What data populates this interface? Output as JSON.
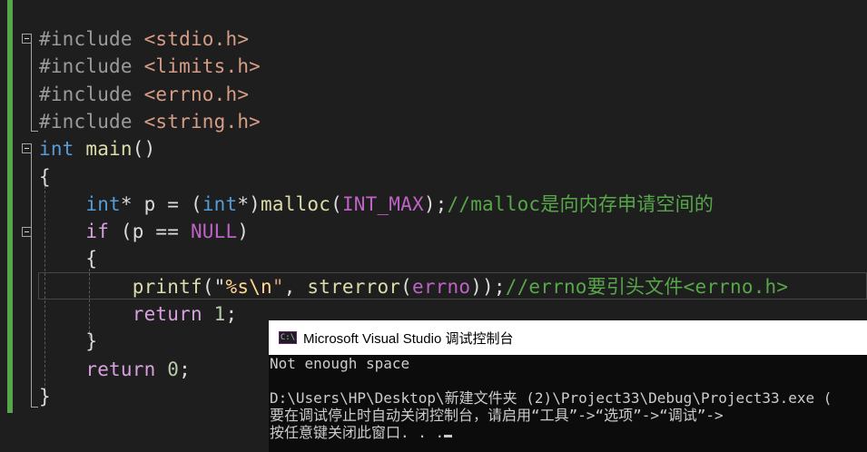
{
  "editor": {
    "lines": [
      [
        {
          "t": "#include ",
          "c": "pp"
        },
        {
          "t": "<stdio.h>",
          "c": "inc"
        }
      ],
      [
        {
          "t": "#include ",
          "c": "pp"
        },
        {
          "t": "<limits.h>",
          "c": "inc"
        }
      ],
      [
        {
          "t": "#include ",
          "c": "pp"
        },
        {
          "t": "<errno.h>",
          "c": "inc"
        }
      ],
      [
        {
          "t": "#include ",
          "c": "pp"
        },
        {
          "t": "<string.h>",
          "c": "inc"
        }
      ],
      [
        {
          "t": "int",
          "c": "kw"
        },
        {
          "t": " "
        },
        {
          "t": "main",
          "c": "fn"
        },
        {
          "t": "()"
        }
      ],
      [
        {
          "t": "{"
        }
      ],
      [
        {
          "t": "    "
        },
        {
          "t": "int",
          "c": "kw"
        },
        {
          "t": "* "
        },
        {
          "t": "p"
        },
        {
          "t": " = ("
        },
        {
          "t": "int",
          "c": "kw"
        },
        {
          "t": "*)"
        },
        {
          "t": "malloc",
          "c": "fn"
        },
        {
          "t": "("
        },
        {
          "t": "INT_MAX",
          "c": "mac"
        },
        {
          "t": ");"
        },
        {
          "t": "//malloc是向内存申请空间的",
          "c": "cmt"
        }
      ],
      [
        {
          "t": "    "
        },
        {
          "t": "if",
          "c": "ctl"
        },
        {
          "t": " (p == "
        },
        {
          "t": "NULL",
          "c": "mac"
        },
        {
          "t": ")"
        }
      ],
      [
        {
          "t": "    {"
        }
      ],
      [
        {
          "t": "        "
        },
        {
          "t": "printf",
          "c": "fn"
        },
        {
          "t": "(\""
        },
        {
          "t": "%s",
          "c": "esc"
        },
        {
          "t": "\\n",
          "c": "esc"
        },
        {
          "t": "\"",
          "c": "str"
        },
        {
          "t": ", "
        },
        {
          "t": "strerror",
          "c": "fn"
        },
        {
          "t": "("
        },
        {
          "t": "errno",
          "c": "mac"
        },
        {
          "t": "));"
        },
        {
          "t": "//errno要引头文件<errno.h>",
          "c": "cmt"
        }
      ],
      [
        {
          "t": "        "
        },
        {
          "t": "return",
          "c": "ctl"
        },
        {
          "t": " "
        },
        {
          "t": "1",
          "c": "num"
        },
        {
          "t": ";"
        }
      ],
      [
        {
          "t": "    }"
        }
      ],
      [
        {
          "t": "    "
        },
        {
          "t": "return",
          "c": "ctl"
        },
        {
          "t": " "
        },
        {
          "t": "0",
          "c": "num"
        },
        {
          "t": ";"
        }
      ],
      [
        {
          "t": "}"
        }
      ]
    ]
  },
  "console": {
    "icon_label": "C:\\",
    "title": "Microsoft Visual Studio 调试控制台",
    "lines": [
      "Not enough space",
      "",
      "D:\\Users\\HP\\Desktop\\新建文件夹 (2)\\Project33\\Debug\\Project33.exe (",
      "要在调试停止时自动关闭控制台，请启用“工具”->“选项”->“调试”->",
      "按任意键关闭此窗口. . ."
    ]
  }
}
